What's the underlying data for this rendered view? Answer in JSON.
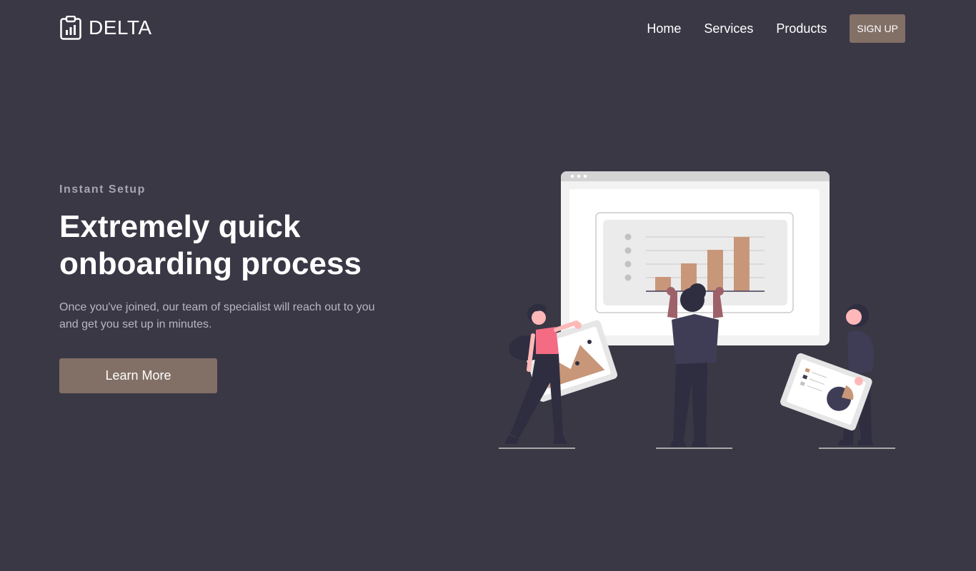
{
  "header": {
    "brand": "DELTA",
    "logo_icon": "clipboard-chart-icon",
    "nav": [
      "Home",
      "Services",
      "Products"
    ],
    "signup_label": "SIGN UP"
  },
  "hero": {
    "eyebrow": "Instant Setup",
    "headline_line1": "Extremely quick",
    "headline_line2": "onboarding process",
    "description": "Once you've joined, our team of specialist will reach out to you and get you set up in minutes.",
    "cta_label": "Learn More"
  },
  "colors": {
    "background": "#3a3845",
    "accent": "#826f66",
    "bar": "#c8977a",
    "pink": "#f46b84",
    "figure_dark": "#2f2e41"
  }
}
